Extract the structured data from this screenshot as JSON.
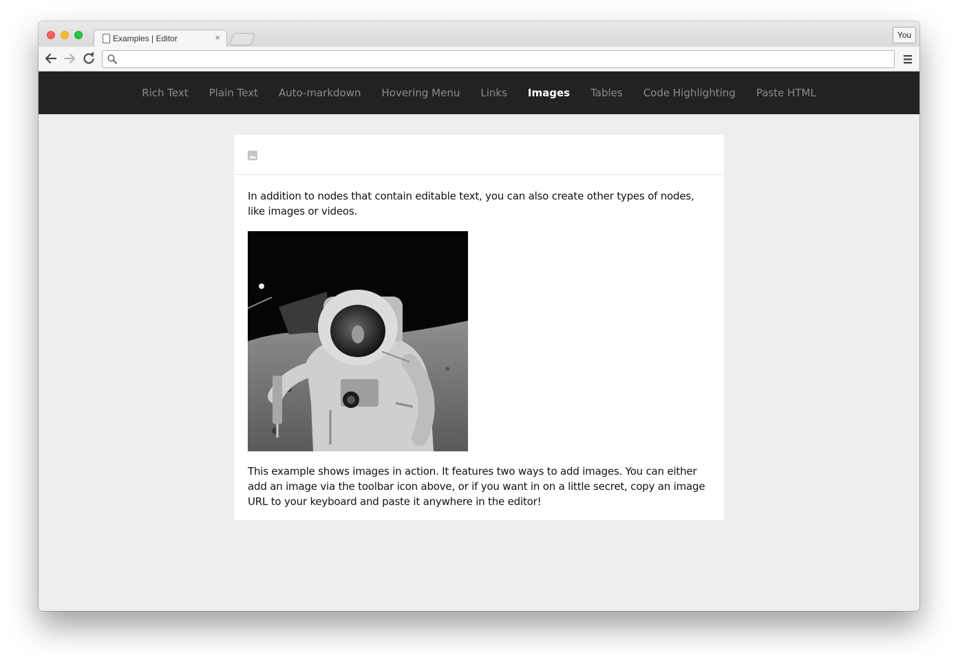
{
  "browser": {
    "tab_title": "Examples | Editor",
    "tab_close": "×",
    "profile_label": "You",
    "address_value": ""
  },
  "nav": {
    "items": [
      {
        "label": "Rich Text",
        "active": false
      },
      {
        "label": "Plain Text",
        "active": false
      },
      {
        "label": "Auto-markdown",
        "active": false
      },
      {
        "label": "Hovering Menu",
        "active": false
      },
      {
        "label": "Links",
        "active": false
      },
      {
        "label": "Images",
        "active": true
      },
      {
        "label": "Tables",
        "active": false
      },
      {
        "label": "Code Highlighting",
        "active": false
      },
      {
        "label": "Paste HTML",
        "active": false
      }
    ]
  },
  "editor": {
    "toolbar_icon": "image-icon",
    "paragraph_1": "In addition to nodes that contain editable text, you can also create other types of nodes, like images or videos.",
    "image_icon": "astronaut-photo",
    "paragraph_2": "This example shows images in action. It features two ways to add images. You can either add an image via the toolbar icon above, or if you want in on a little secret, copy an image URL to your keyboard and paste it anywhere in the editor!"
  },
  "colors": {
    "nav_bg": "#222222",
    "nav_active": "#ffffff",
    "nav_inactive": "#8c8c8c",
    "page_bg": "#eeeeee",
    "editor_bg": "#ffffff"
  }
}
